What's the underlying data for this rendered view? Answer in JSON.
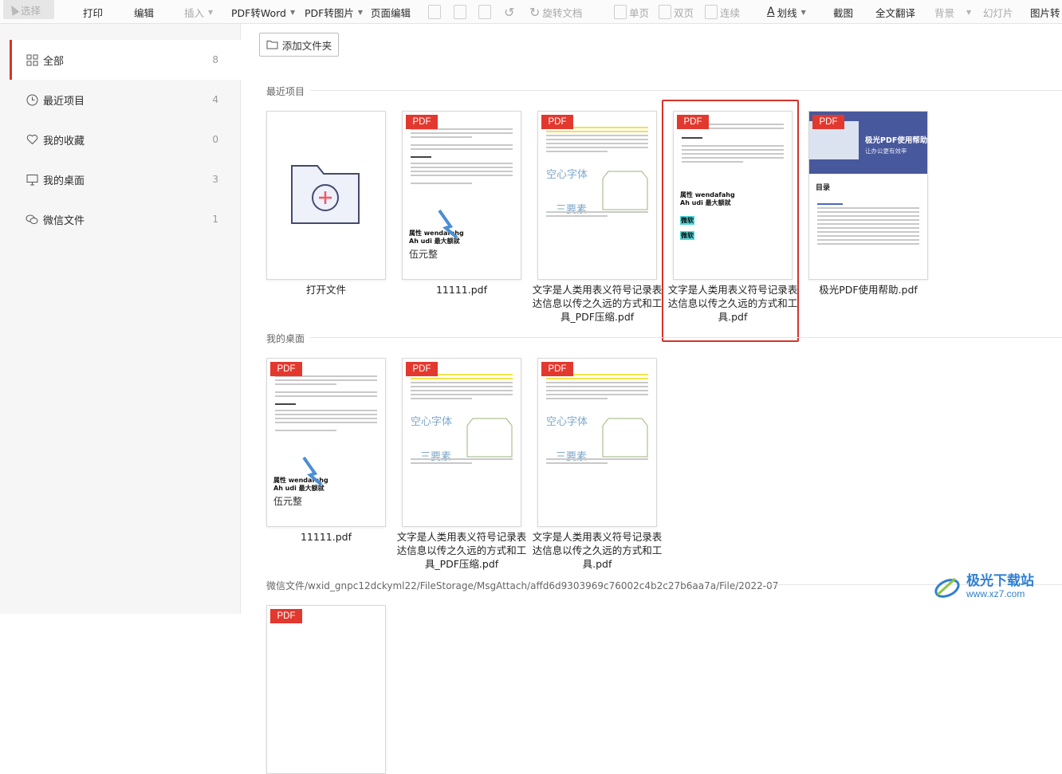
{
  "toolbar": {
    "select": "选择",
    "print": "打印",
    "edit": "编辑",
    "insert": "插入",
    "pdf_to_word": "PDF转Word",
    "pdf_to_image": "PDF转图片",
    "page_edit": "页面编辑",
    "rotate_doc": "旋转文档",
    "single_page": "单页",
    "double_page": "双页",
    "continuous": "连续",
    "strikethrough": "划线",
    "screenshot": "截图",
    "full_translate": "全文翻译",
    "background": "背景",
    "slideshow": "幻灯片",
    "image_to": "图片转"
  },
  "sidebar": {
    "items": [
      {
        "label": "全部",
        "count": "8",
        "icon": "grid-icon"
      },
      {
        "label": "最近项目",
        "count": "4",
        "icon": "clock-icon"
      },
      {
        "label": "我的收藏",
        "count": "0",
        "icon": "heart-icon"
      },
      {
        "label": "我的桌面",
        "count": "3",
        "icon": "monitor-icon"
      },
      {
        "label": "微信文件",
        "count": "1",
        "icon": "wechat-icon"
      }
    ]
  },
  "main": {
    "add_folder": "添加文件夹",
    "sections": {
      "recent": "最近项目",
      "desktop": "我的桌面",
      "wechat_path": "微信文件/wxid_gnpc12dckyml22/FileStorage/MsgAttach/affd6d9303969c76002c4b2c27b6aa7a/File/2022-07"
    },
    "recent_files": [
      {
        "name": "打开文件"
      },
      {
        "name": "11111.pdf",
        "tag": "PDF"
      },
      {
        "name": "文字是人类用表义符号记录表达信息以传之久远的方式和工具_PDF压缩.pdf",
        "tag": "PDF"
      },
      {
        "name": "文字是人类用表义符号记录表达信息以传之久远的方式和工具.pdf",
        "tag": "PDF"
      },
      {
        "name": "极光PDF使用帮助.pdf",
        "tag": "PDF"
      }
    ],
    "desktop_files": [
      {
        "name": "11111.pdf",
        "tag": "PDF"
      },
      {
        "name": "文字是人类用表义符号记录表达信息以传之久远的方式和工具_PDF压缩.pdf",
        "tag": "PDF"
      },
      {
        "name": "文字是人类用表义符号记录表达信息以传之久远的方式和工具.pdf",
        "tag": "PDF"
      }
    ],
    "wechat_files": [
      {
        "tag": "PDF"
      }
    ],
    "thumb_text": {
      "attr_line1": "属性 wendafahg",
      "attr_line2": "Ah udi 最大额就",
      "amount": "伍元整",
      "heart_font": "空心字体",
      "three_elements": "三要素",
      "highlight": "微软",
      "help_title": "极光PDF使用帮助",
      "help_sub": "让办公更有效率",
      "toc": "目录"
    }
  },
  "watermark": {
    "text": "极光下载站",
    "url": "www.xz7.com"
  },
  "colors": {
    "accent": "#d9342b",
    "pdf_tag": "#e2382e",
    "help_banner": "#47589c"
  }
}
